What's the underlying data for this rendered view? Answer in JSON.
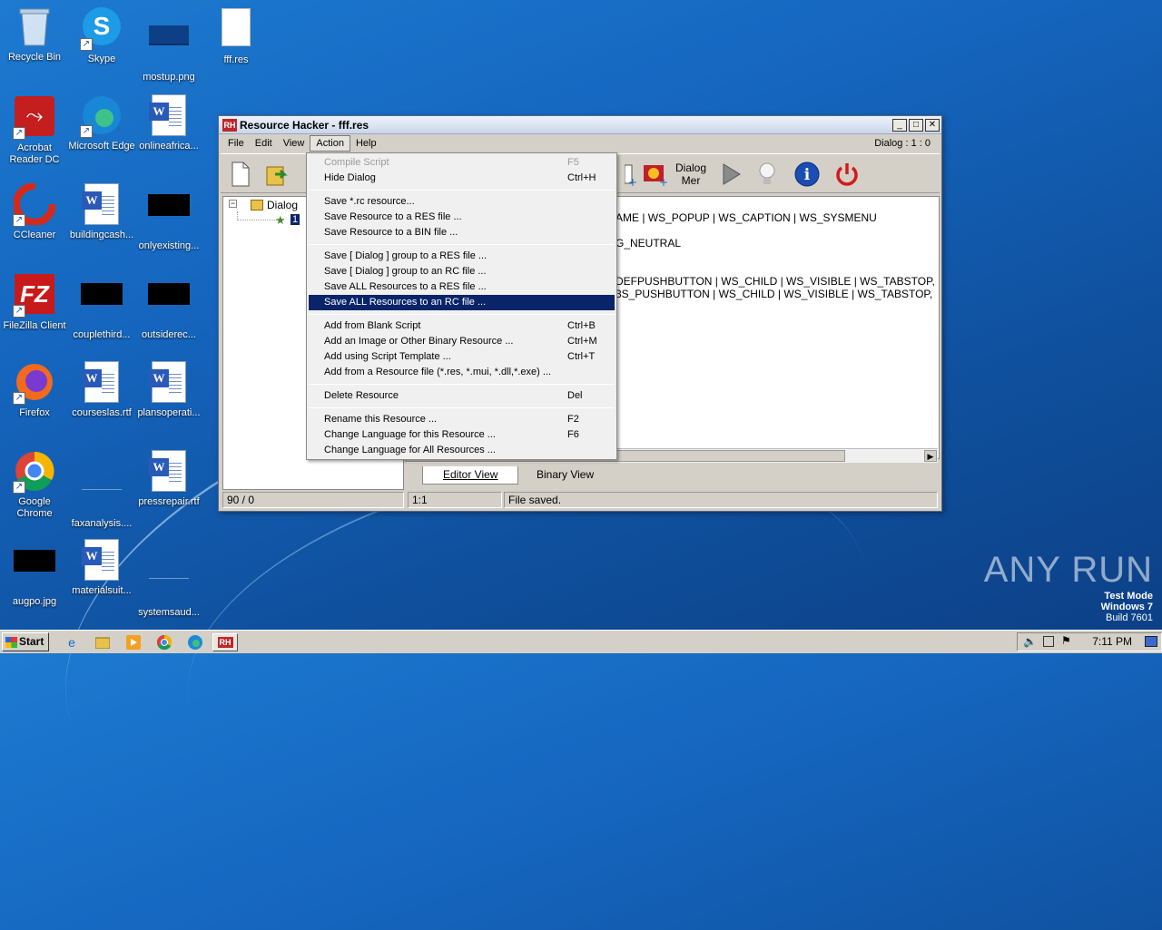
{
  "desktop": {
    "icons": [
      {
        "label": "Recycle Bin"
      },
      {
        "label": "Skype"
      },
      {
        "label": "mostup.png"
      },
      {
        "label": "fff.res"
      },
      {
        "label": "Acrobat Reader DC"
      },
      {
        "label": "Microsoft Edge"
      },
      {
        "label": "onlineafrica..."
      },
      {
        "label": "CCleaner"
      },
      {
        "label": "buildingcash..."
      },
      {
        "label": "onlyexisting..."
      },
      {
        "label": "FileZilla Client"
      },
      {
        "label": "couplethird..."
      },
      {
        "label": "outsiderec..."
      },
      {
        "label": "Firefox"
      },
      {
        "label": "courseslas.rtf"
      },
      {
        "label": "plansoperati..."
      },
      {
        "label": "Google Chrome"
      },
      {
        "label": "faxanalysis...."
      },
      {
        "label": "pressrepair.rtf"
      },
      {
        "label": "augpo.jpg"
      },
      {
        "label": "materialsuit..."
      },
      {
        "label": "systemsaud..."
      }
    ]
  },
  "window": {
    "title": "Resource Hacker - fff.res",
    "app_icon": "RH",
    "menu": [
      "File",
      "Edit",
      "View",
      "Action",
      "Help"
    ],
    "menu_status": "Dialog : 1 : 0",
    "toolbar_icons": [
      "new-file-icon",
      "open-folder-icon",
      "add-resource-icon",
      "dialog-image-icon",
      "dialog-menu-icon",
      "play-icon",
      "lightbulb-icon",
      "info-icon",
      "power-icon"
    ],
    "toolbar_dialog_label": "Dialog Mer",
    "tree": {
      "root": "Dialog",
      "child": "1"
    },
    "code_lines": [
      "AME | WS_POPUP | WS_CAPTION | WS_SYSMENU",
      "G_NEUTRAL",
      "DEFPUSHBUTTON | WS_CHILD | WS_VISIBLE | WS_TABSTOP,",
      "3S_PUSHBUTTON | WS_CHILD | WS_VISIBLE | WS_TABSTOP,"
    ],
    "tabs": [
      "Editor View",
      "Binary View"
    ],
    "status": {
      "pos": "90 / 0",
      "cursor": "1:1",
      "message": "File saved."
    }
  },
  "action_menu": {
    "groups": [
      [
        {
          "label": "Compile Script",
          "shortcut": "F5",
          "disabled": true
        },
        {
          "label": "Hide Dialog",
          "shortcut": "Ctrl+H"
        }
      ],
      [
        {
          "label": "Save *.rc resource...",
          "shortcut": ""
        },
        {
          "label": "Save Resource to a RES file ...",
          "shortcut": ""
        },
        {
          "label": "Save Resource to a BIN file ...",
          "shortcut": ""
        }
      ],
      [
        {
          "label": "Save [ Dialog ] group to a RES file ...",
          "shortcut": ""
        },
        {
          "label": "Save [ Dialog ] group to an RC file ...",
          "shortcut": ""
        },
        {
          "label": "Save ALL Resources to a RES file ...",
          "shortcut": ""
        },
        {
          "label": "Save ALL Resources to an RC file ...",
          "shortcut": "",
          "highlighted": true
        }
      ],
      [
        {
          "label": "Add from Blank Script",
          "shortcut": "Ctrl+B"
        },
        {
          "label": "Add an Image or Other Binary Resource ...",
          "shortcut": "Ctrl+M"
        },
        {
          "label": "Add using Script Template ...",
          "shortcut": "Ctrl+T"
        },
        {
          "label": "Add from a Resource file (*.res, *.mui, *.dll,*.exe) ...",
          "shortcut": ""
        }
      ],
      [
        {
          "label": "Delete Resource",
          "shortcut": "Del"
        }
      ],
      [
        {
          "label": "Rename this Resource ...",
          "shortcut": "F2"
        },
        {
          "label": "Change Language for this Resource ...",
          "shortcut": "F6"
        },
        {
          "label": "Change Language for All Resources ...",
          "shortcut": ""
        }
      ]
    ]
  },
  "taskbar": {
    "start": "Start",
    "clock": "7:11 PM",
    "app_icons": [
      "ie-icon",
      "explorer-icon",
      "media-player-icon",
      "chrome-icon",
      "edge-icon",
      "resource-hacker-icon"
    ]
  },
  "watermark": {
    "brand": "ANY RUN",
    "line1": "Test Mode",
    "line2": "Windows 7",
    "line3": "Build 7601"
  }
}
